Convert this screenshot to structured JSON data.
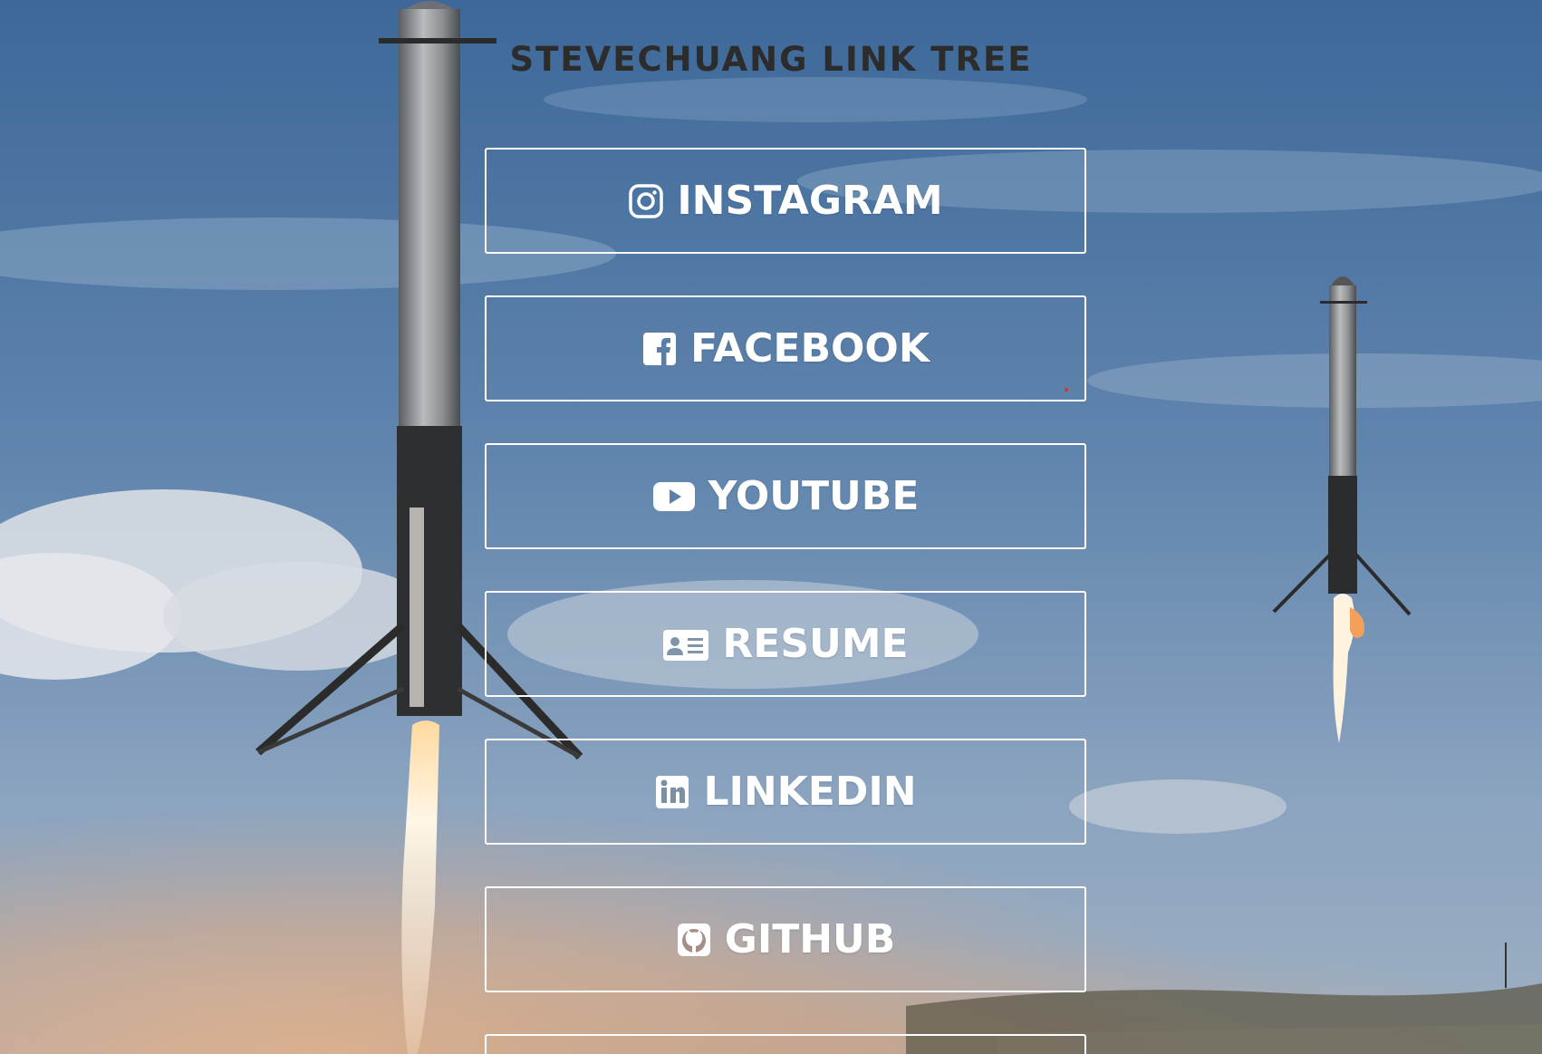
{
  "page": {
    "title": "STEVECHUANG LINK TREE"
  },
  "colors": {
    "sky_top": "#3f6b9c",
    "sky_bottom": "#8fa8c2",
    "dust": "#d8a57d",
    "button_border": "#ffffff",
    "title_text": "#2c2c2c"
  },
  "links": [
    {
      "label": "INSTAGRAM",
      "icon": "instagram-icon"
    },
    {
      "label": "FACEBOOK",
      "icon": "facebook-icon"
    },
    {
      "label": "YOUTUBE",
      "icon": "youtube-icon"
    },
    {
      "label": "RESUME",
      "icon": "id-card-icon"
    },
    {
      "label": "LINKEDIN",
      "icon": "linkedin-icon"
    },
    {
      "label": "GITHUB",
      "icon": "github-icon"
    }
  ]
}
